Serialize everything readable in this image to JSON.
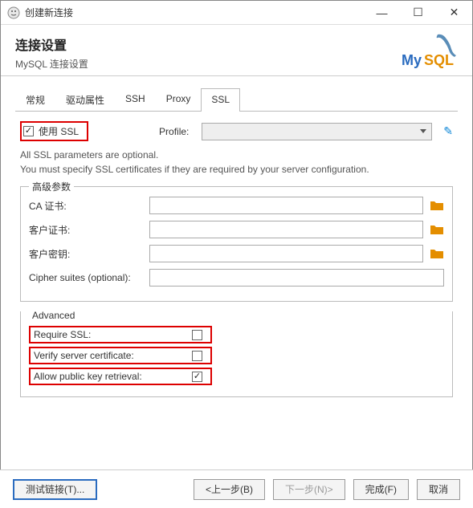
{
  "window": {
    "title": "创建新连接",
    "min": "—",
    "max": "☐",
    "close": "✕"
  },
  "header": {
    "title": "连接设置",
    "subtitle": "MySQL 连接设置"
  },
  "tabs": [
    "常规",
    "驱动属性",
    "SSH",
    "Proxy",
    "SSL"
  ],
  "ssl": {
    "use_ssl": "使用 SSL",
    "profile_label": "Profile:",
    "help1": "All SSL parameters are optional.",
    "help2": "You must specify SSL certificates if they are required by your server configuration.",
    "advanced_legend": "高级参数",
    "ca_cert": "CA 证书:",
    "client_cert": "客户证书:",
    "client_key": "客户密钥:",
    "cipher": "Cipher suites (optional):",
    "advanced2": "Advanced",
    "require_ssl": "Require SSL:",
    "verify_cert": "Verify server certificate:",
    "allow_pkr": "Allow public key retrieval:"
  },
  "footer": {
    "test": "测试链接(T)...",
    "back": "<上一步(B)",
    "next": "下一步(N)>",
    "finish": "完成(F)",
    "cancel": "取消"
  }
}
